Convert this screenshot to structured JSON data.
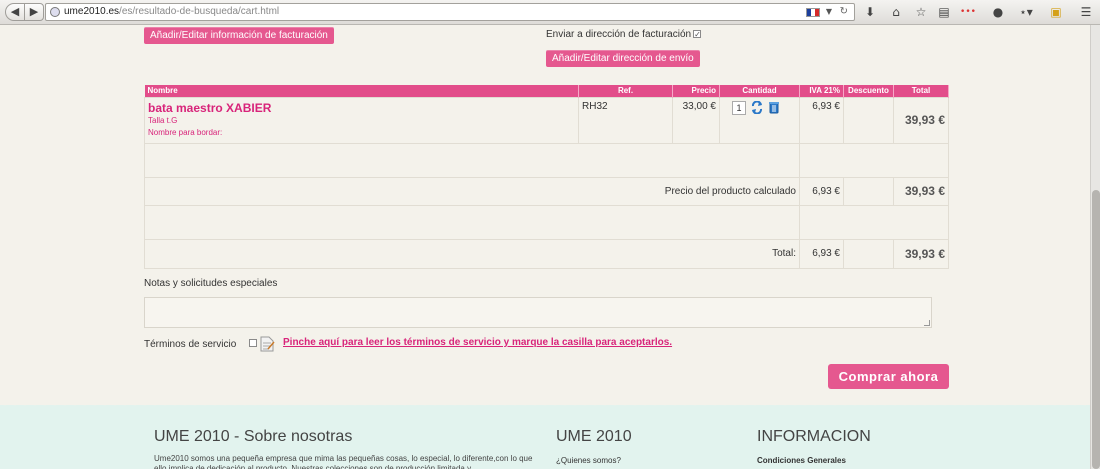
{
  "browser": {
    "url_domain": "ume2010.es",
    "url_path": "/es/resultado-de-busqueda/cart.html"
  },
  "billing": {
    "edit_billing_button": "Añadir/Editar información de facturación",
    "ship_to_billing_label": "Enviar a dirección de facturación",
    "edit_shipping_button": "Añadir/Editar dirección de envío"
  },
  "cart": {
    "headers": [
      "Nombre",
      "Ref.",
      "Precio",
      "Cantidad",
      "IVA 21%",
      "Descuento",
      "Total"
    ],
    "item": {
      "name": "bata maestro XABIER",
      "attr_size": "Talla t.G",
      "attr_embroidery": "Nombre para bordar:",
      "ref": "RH32",
      "price": "33,00 €",
      "quantity": "1",
      "tax": "6,93 €",
      "total": "39,93 €"
    },
    "subtotal_label": "Precio del producto calculado",
    "subtotal_tax": "6,93 €",
    "subtotal_total": "39,93 €",
    "grand_label": "Total:",
    "grand_tax": "6,93 €",
    "grand_total": "39,93 €"
  },
  "notes": {
    "label": "Notas y solicitudes especiales"
  },
  "tos": {
    "label": "Términos de servicio",
    "link": "Pinche aquí para leer los términos de servicio y marque la casilla para aceptarlos."
  },
  "checkout_button": "Comprar ahora",
  "footer": {
    "about_title": "UME 2010 - Sobre nosotras",
    "about_text": "Ume2010 somos una pequeña empresa que mima las pequeñas cosas, lo especial, lo diferente,con lo que ello implica de dedicación al producto. Nuestras colecciones son de producción limitada y",
    "col2_title": "UME 2010",
    "col2_link": "¿Quienes somos?",
    "col3_title": "INFORMACION",
    "col3_link": "Condiciones Generales"
  },
  "colors": {
    "accent": "#e5588f",
    "link": "#d8247a",
    "footer_bg": "#e2f3ee"
  }
}
